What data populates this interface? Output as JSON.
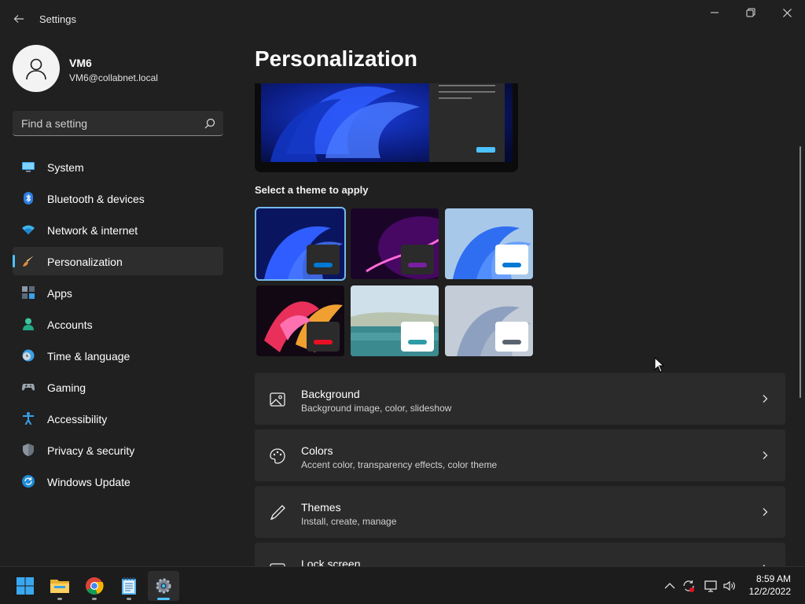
{
  "window": {
    "title": "Settings"
  },
  "user": {
    "name": "VM6",
    "email": "VM6@collabnet.local"
  },
  "search": {
    "placeholder": "Find a setting"
  },
  "nav": {
    "items": [
      {
        "label": "System",
        "icon": "monitor-icon",
        "selected": false
      },
      {
        "label": "Bluetooth & devices",
        "icon": "bluetooth-icon",
        "selected": false
      },
      {
        "label": "Network & internet",
        "icon": "wifi-icon",
        "selected": false
      },
      {
        "label": "Personalization",
        "icon": "brush-icon",
        "selected": true
      },
      {
        "label": "Apps",
        "icon": "apps-icon",
        "selected": false
      },
      {
        "label": "Accounts",
        "icon": "person-icon",
        "selected": false
      },
      {
        "label": "Time & language",
        "icon": "clock-globe-icon",
        "selected": false
      },
      {
        "label": "Gaming",
        "icon": "gamepad-icon",
        "selected": false
      },
      {
        "label": "Accessibility",
        "icon": "accessibility-icon",
        "selected": false
      },
      {
        "label": "Privacy & security",
        "icon": "shield-icon",
        "selected": false
      },
      {
        "label": "Windows Update",
        "icon": "update-icon",
        "selected": false
      }
    ]
  },
  "main": {
    "title": "Personalization",
    "theme_section_label": "Select a theme to apply",
    "themes": [
      {
        "name": "windows-dark",
        "accent": "#0078d4",
        "selected": true
      },
      {
        "name": "glow",
        "accent": "#7a1fa2",
        "selected": false
      },
      {
        "name": "windows-light",
        "accent": "#0078d4",
        "selected": false
      },
      {
        "name": "captured-motion",
        "accent": "#e81123",
        "selected": false
      },
      {
        "name": "sunrise",
        "accent": "#2d9ca8",
        "selected": false
      },
      {
        "name": "flow",
        "accent": "#5a6470",
        "selected": false
      }
    ],
    "cards": [
      {
        "title": "Background",
        "subtitle": "Background image, color, slideshow",
        "icon": "picture-icon"
      },
      {
        "title": "Colors",
        "subtitle": "Accent color, transparency effects, color theme",
        "icon": "palette-icon"
      },
      {
        "title": "Themes",
        "subtitle": "Install, create, manage",
        "icon": "pen-icon"
      },
      {
        "title": "Lock screen",
        "subtitle": "",
        "icon": "lock-screen-icon"
      }
    ]
  },
  "taskbar": {
    "apps": [
      "start-icon",
      "file-explorer-icon",
      "chrome-icon",
      "notepad-icon",
      "settings-icon"
    ],
    "clock": {
      "time": "8:59 AM",
      "date": "12/2/2022"
    }
  },
  "colors": {
    "accent": "#4cc2ff",
    "background": "#202020",
    "card": "#2b2b2b"
  }
}
